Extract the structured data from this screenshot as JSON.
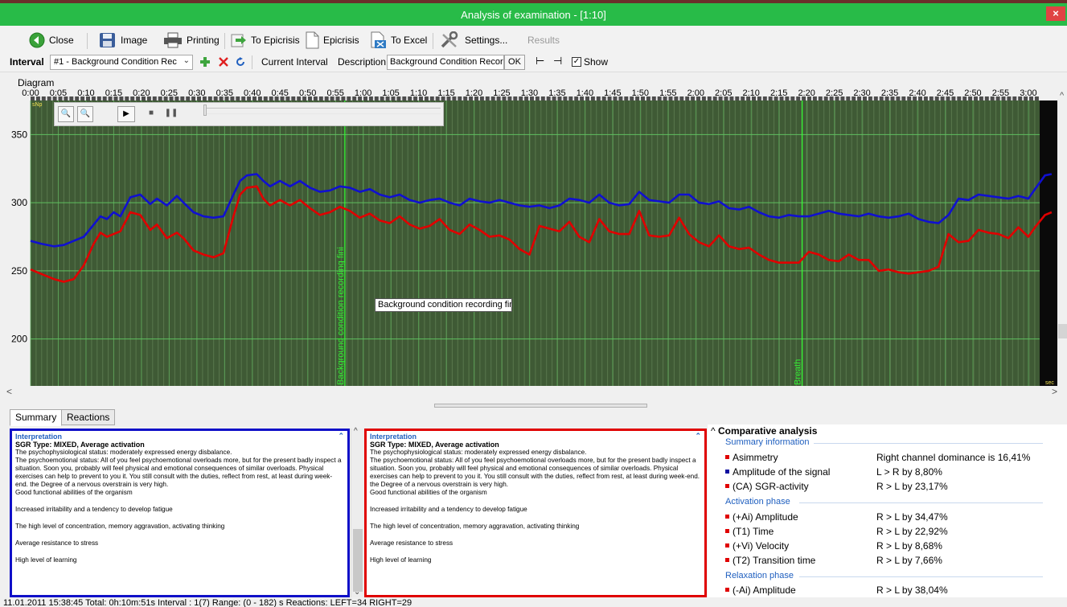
{
  "window": {
    "title": "Analysis of examination - [1:10]",
    "close_glyph": "×"
  },
  "toolbar": {
    "close": "Close",
    "image": "Image",
    "printing": "Printing",
    "to_epicrisis": "To Epicrisis",
    "epicrisis": "Epicrisis",
    "to_excel": "To Excel",
    "settings": "Settings...",
    "results": "Results"
  },
  "interval_bar": {
    "label": "Interval",
    "selected": "#1 - Background Condition Rec",
    "current_interval": "Current Interval",
    "description_label": "Description",
    "description_value": "Background Condition Record",
    "ok": "OK",
    "show": "Show"
  },
  "diagram": {
    "label": "Diagram",
    "tooltip": "Background condition recording fini",
    "marker_bg": "Background condition recording fini",
    "marker_breath": "Breath",
    "corner_top": "sNp",
    "corner_bottom": "sec"
  },
  "chart_data": {
    "type": "line",
    "x_unit": "minutes",
    "x_ticks": [
      "0:00",
      "0:05",
      "0:10",
      "0:15",
      "0:20",
      "0:25",
      "0:30",
      "0:35",
      "0:40",
      "0:45",
      "0:50",
      "0:55",
      "1:00",
      "1:05",
      "1:10",
      "1:15",
      "1:20",
      "1:25",
      "1:30",
      "1:35",
      "1:40",
      "1:45",
      "1:50",
      "1:55",
      "2:00",
      "2:05",
      "2:10",
      "2:15",
      "2:20",
      "2:25",
      "2:30",
      "2:35",
      "2:40",
      "2:45",
      "2:50",
      "2:55",
      "3:00"
    ],
    "y_ticks": [
      200,
      250,
      300,
      350
    ],
    "ylim": [
      165,
      375
    ],
    "xlim": [
      0,
      3.07
    ],
    "grid": true,
    "markers": [
      {
        "x": 0.945,
        "label": "Background condition recording fini"
      },
      {
        "x": 2.32,
        "label": "Breath"
      }
    ],
    "series": [
      {
        "color": "#1010d0",
        "points": [
          [
            0,
            272
          ],
          [
            0.03,
            270
          ],
          [
            0.07,
            268
          ],
          [
            0.1,
            269
          ],
          [
            0.13,
            272
          ],
          [
            0.16,
            275
          ],
          [
            0.19,
            284
          ],
          [
            0.21,
            290
          ],
          [
            0.23,
            288
          ],
          [
            0.25,
            293
          ],
          [
            0.27,
            290
          ],
          [
            0.3,
            304
          ],
          [
            0.33,
            306
          ],
          [
            0.36,
            299
          ],
          [
            0.38,
            303
          ],
          [
            0.41,
            298
          ],
          [
            0.44,
            305
          ],
          [
            0.46,
            300
          ],
          [
            0.49,
            293
          ],
          [
            0.52,
            290
          ],
          [
            0.55,
            289
          ],
          [
            0.58,
            290
          ],
          [
            0.61,
            306
          ],
          [
            0.63,
            316
          ],
          [
            0.65,
            320
          ],
          [
            0.68,
            321
          ],
          [
            0.7,
            316
          ],
          [
            0.72,
            312
          ],
          [
            0.75,
            316
          ],
          [
            0.78,
            312
          ],
          [
            0.81,
            316
          ],
          [
            0.84,
            311
          ],
          [
            0.87,
            308
          ],
          [
            0.9,
            309
          ],
          [
            0.93,
            312
          ],
          [
            0.96,
            311
          ],
          [
            0.99,
            308
          ],
          [
            1.02,
            310
          ],
          [
            1.05,
            306
          ],
          [
            1.08,
            304
          ],
          [
            1.11,
            306
          ],
          [
            1.14,
            302
          ],
          [
            1.17,
            300
          ],
          [
            1.2,
            302
          ],
          [
            1.23,
            303
          ],
          [
            1.26,
            300
          ],
          [
            1.29,
            298
          ],
          [
            1.32,
            303
          ],
          [
            1.35,
            301
          ],
          [
            1.38,
            300
          ],
          [
            1.41,
            302
          ],
          [
            1.44,
            300
          ],
          [
            1.47,
            298
          ],
          [
            1.5,
            297
          ],
          [
            1.53,
            298
          ],
          [
            1.56,
            296
          ],
          [
            1.59,
            298
          ],
          [
            1.62,
            303
          ],
          [
            1.65,
            302
          ],
          [
            1.68,
            300
          ],
          [
            1.71,
            306
          ],
          [
            1.74,
            300
          ],
          [
            1.77,
            298
          ],
          [
            1.8,
            299
          ],
          [
            1.83,
            308
          ],
          [
            1.86,
            302
          ],
          [
            1.89,
            301
          ],
          [
            1.92,
            300
          ],
          [
            1.95,
            306
          ],
          [
            1.98,
            306
          ],
          [
            2.01,
            300
          ],
          [
            2.04,
            299
          ],
          [
            2.07,
            301
          ],
          [
            2.1,
            296
          ],
          [
            2.13,
            295
          ],
          [
            2.16,
            297
          ],
          [
            2.19,
            293
          ],
          [
            2.22,
            290
          ],
          [
            2.25,
            289
          ],
          [
            2.28,
            291
          ],
          [
            2.31,
            290
          ],
          [
            2.34,
            290
          ],
          [
            2.37,
            292
          ],
          [
            2.4,
            294
          ],
          [
            2.43,
            292
          ],
          [
            2.46,
            291
          ],
          [
            2.49,
            290
          ],
          [
            2.52,
            292
          ],
          [
            2.55,
            290
          ],
          [
            2.58,
            289
          ],
          [
            2.61,
            290
          ],
          [
            2.64,
            292
          ],
          [
            2.67,
            288
          ],
          [
            2.7,
            286
          ],
          [
            2.73,
            285
          ],
          [
            2.76,
            291
          ],
          [
            2.79,
            303
          ],
          [
            2.82,
            302
          ],
          [
            2.85,
            306
          ],
          [
            2.88,
            305
          ],
          [
            2.91,
            304
          ],
          [
            2.94,
            303
          ],
          [
            2.97,
            305
          ],
          [
            3.0,
            303
          ],
          [
            3.02,
            310
          ],
          [
            3.05,
            320
          ],
          [
            3.07,
            321
          ]
        ]
      },
      {
        "color": "#e00000",
        "points": [
          [
            0,
            251
          ],
          [
            0.03,
            248
          ],
          [
            0.07,
            244
          ],
          [
            0.1,
            242
          ],
          [
            0.13,
            244
          ],
          [
            0.16,
            254
          ],
          [
            0.19,
            270
          ],
          [
            0.21,
            278
          ],
          [
            0.23,
            275
          ],
          [
            0.25,
            277
          ],
          [
            0.27,
            279
          ],
          [
            0.3,
            293
          ],
          [
            0.33,
            291
          ],
          [
            0.36,
            280
          ],
          [
            0.38,
            284
          ],
          [
            0.41,
            274
          ],
          [
            0.44,
            278
          ],
          [
            0.46,
            274
          ],
          [
            0.49,
            265
          ],
          [
            0.52,
            262
          ],
          [
            0.55,
            260
          ],
          [
            0.58,
            263
          ],
          [
            0.61,
            290
          ],
          [
            0.63,
            306
          ],
          [
            0.65,
            311
          ],
          [
            0.68,
            312
          ],
          [
            0.7,
            303
          ],
          [
            0.72,
            298
          ],
          [
            0.75,
            302
          ],
          [
            0.78,
            298
          ],
          [
            0.81,
            302
          ],
          [
            0.84,
            296
          ],
          [
            0.87,
            291
          ],
          [
            0.9,
            293
          ],
          [
            0.93,
            297
          ],
          [
            0.96,
            294
          ],
          [
            0.99,
            289
          ],
          [
            1.02,
            292
          ],
          [
            1.05,
            287
          ],
          [
            1.08,
            285
          ],
          [
            1.11,
            290
          ],
          [
            1.14,
            284
          ],
          [
            1.17,
            281
          ],
          [
            1.2,
            283
          ],
          [
            1.23,
            288
          ],
          [
            1.26,
            280
          ],
          [
            1.29,
            277
          ],
          [
            1.32,
            284
          ],
          [
            1.35,
            280
          ],
          [
            1.38,
            275
          ],
          [
            1.41,
            276
          ],
          [
            1.44,
            273
          ],
          [
            1.47,
            266
          ],
          [
            1.5,
            262
          ],
          [
            1.53,
            283
          ],
          [
            1.56,
            281
          ],
          [
            1.59,
            279
          ],
          [
            1.62,
            286
          ],
          [
            1.65,
            275
          ],
          [
            1.68,
            271
          ],
          [
            1.71,
            288
          ],
          [
            1.74,
            279
          ],
          [
            1.77,
            277
          ],
          [
            1.8,
            277
          ],
          [
            1.83,
            294
          ],
          [
            1.86,
            276
          ],
          [
            1.89,
            275
          ],
          [
            1.92,
            276
          ],
          [
            1.95,
            289
          ],
          [
            1.98,
            277
          ],
          [
            2.01,
            271
          ],
          [
            2.04,
            268
          ],
          [
            2.07,
            276
          ],
          [
            2.1,
            268
          ],
          [
            2.13,
            266
          ],
          [
            2.16,
            267
          ],
          [
            2.19,
            262
          ],
          [
            2.22,
            258
          ],
          [
            2.25,
            256
          ],
          [
            2.28,
            256
          ],
          [
            2.31,
            256
          ],
          [
            2.34,
            264
          ],
          [
            2.37,
            262
          ],
          [
            2.4,
            258
          ],
          [
            2.43,
            257
          ],
          [
            2.46,
            262
          ],
          [
            2.49,
            258
          ],
          [
            2.52,
            258
          ],
          [
            2.55,
            250
          ],
          [
            2.58,
            251
          ],
          [
            2.61,
            249
          ],
          [
            2.64,
            248
          ],
          [
            2.67,
            249
          ],
          [
            2.7,
            250
          ],
          [
            2.73,
            253
          ],
          [
            2.76,
            277
          ],
          [
            2.79,
            271
          ],
          [
            2.82,
            272
          ],
          [
            2.85,
            280
          ],
          [
            2.88,
            278
          ],
          [
            2.91,
            277
          ],
          [
            2.94,
            274
          ],
          [
            2.97,
            282
          ],
          [
            3.0,
            275
          ],
          [
            3.02,
            282
          ],
          [
            3.05,
            291
          ],
          [
            3.07,
            293
          ]
        ]
      }
    ]
  },
  "tabs": [
    {
      "label": "Summary"
    },
    {
      "label": "Reactions"
    }
  ],
  "interpretation": {
    "header": "Interpretation",
    "type_line": "SGR Type: MIXED, Average activation",
    "para1": "The psychophysiological status: moderately expressed energy disbalance.",
    "para2": "The psychoemotional status:  All of you feel psychoemotional overloads more, but for the present badly inspect a situation. Soon you, probably will feel physical and emotional consequences of similar overloads. Physical exercises can help to prevent to you it. You still consult with the duties, reflect from rest, at least during week-end. the Degree of a nervous overstrain is very high.",
    "para3": "Good functional abilities of the organism",
    "line4": "Increased irritability and a tendency to develop fatigue",
    "line5": "The high level of concentration, memory aggravation, activating thinking",
    "line6": "Average resistance to stress",
    "line7": "High level of learning"
  },
  "comparative": {
    "title": "Comparative analysis",
    "summary_header": "Summary information",
    "activation_header": "Activation phase",
    "relaxation_header": "Relaxation phase",
    "rows": [
      {
        "name": "Asimmetry",
        "value": "Right channel dominance is 16,41%",
        "color": "#e00000"
      },
      {
        "name": "Amplitude of the signal",
        "value": "L > R by 8,80%",
        "color": "#1010a0"
      },
      {
        "name": "(CA) SGR-activity",
        "value": "R > L by 23,17%",
        "color": "#e00000"
      },
      {
        "name": "(+Ai) Amplitude",
        "value": "R > L by 34,47%",
        "color": "#e00000"
      },
      {
        "name": "(T1) Time",
        "value": "R > L by 22,92%",
        "color": "#e00000"
      },
      {
        "name": "(+Vi) Velocity",
        "value": "R > L by 8,68%",
        "color": "#e00000"
      },
      {
        "name": "(T2) Transition time",
        "value": "R > L by 7,66%",
        "color": "#e00000"
      },
      {
        "name": "(-Ai) Amplitude",
        "value": "R > L by 38,04%",
        "color": "#e00000"
      }
    ]
  },
  "status": {
    "text": "11.01.2011 15:38:45  Total: 0h:10m:51s  Interval : 1(7)  Range: (0 - 182) s  Reactions: LEFT=34  RIGHT=29"
  },
  "colors": {
    "titlebar": "#28bb48",
    "chart_bg": "#305030",
    "grid_major": "#5fbf5f",
    "left_panel_border": "#1010c8",
    "right_panel_border": "#e00000",
    "accent_text": "#1f5fbf"
  },
  "icons": [
    "back-arrow-icon",
    "floppy-disk-icon",
    "printer-icon",
    "export-arrow-icon",
    "document-icon",
    "excel-icon",
    "wrench-icon",
    "plus-icon",
    "delete-x-icon",
    "refresh-icon",
    "jump-start-icon",
    "jump-end-icon",
    "zoom-in-icon",
    "zoom-out-icon",
    "play-icon",
    "stop-icon",
    "pause-icon"
  ]
}
